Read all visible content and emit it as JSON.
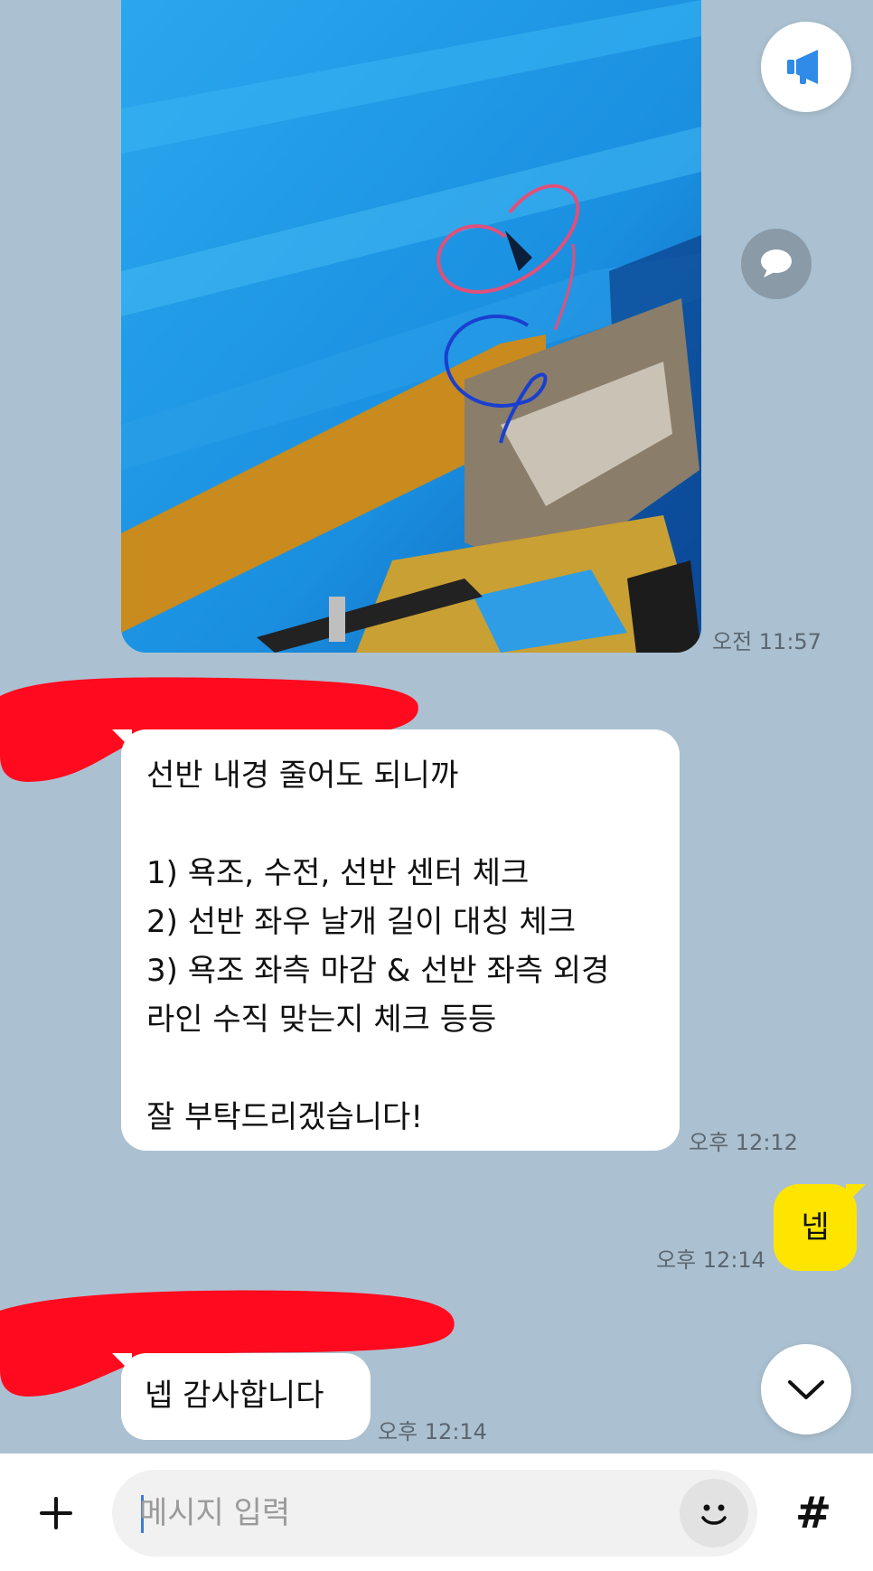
{
  "messages": [
    {
      "type": "image",
      "sender": "other",
      "time": "오전 11:57"
    },
    {
      "type": "text",
      "sender": "other",
      "lines": [
        "선반 내경 줄어도 되니까",
        "",
        "1) 욕조, 수전, 선반 센터 체크",
        "2) 선반 좌우 날개 길이 대칭 체크",
        "3) 욕조 좌측 마감 & 선반 좌측 외경",
        "라인 수직 맞는지 체크 등등",
        "",
        "잘 부탁드리겠습니다!"
      ],
      "time": "오후 12:12"
    },
    {
      "type": "text",
      "sender": "me",
      "text": "넵",
      "time": "오후 12:14"
    },
    {
      "type": "text",
      "sender": "other",
      "text": "넵 감사합니다",
      "time": "오후 12:14"
    }
  ],
  "input": {
    "placeholder": "메시지 입력",
    "value": ""
  },
  "icons": {
    "notice": "megaphone-icon",
    "comment": "speech-bubble-icon",
    "scroll_down": "chevron-down-icon",
    "attach": "plus-icon",
    "emoji": "emoji-icon",
    "hashtag": "hash-icon"
  },
  "hashtag_label": "#",
  "colors": {
    "background": "#abc1d1",
    "my_bubble": "#fee500",
    "other_bubble": "#ffffff",
    "redaction": "#ff0a1e",
    "notice_accent": "#2f8ae8"
  }
}
